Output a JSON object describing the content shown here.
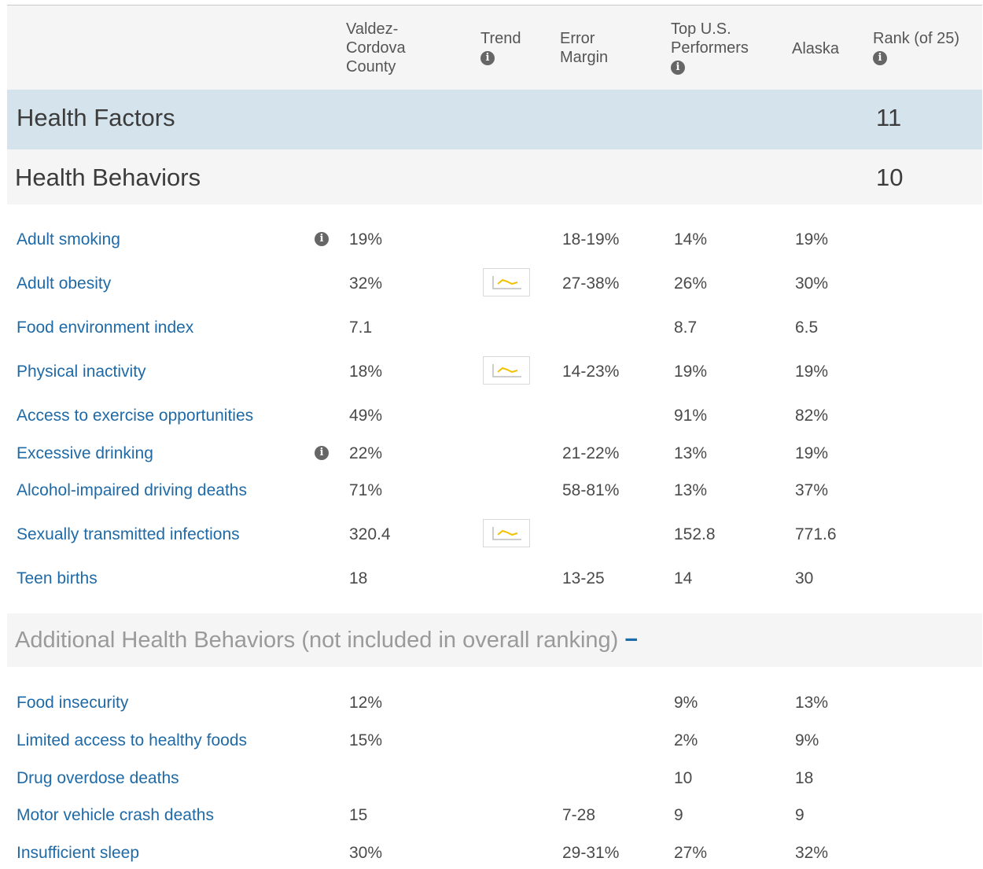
{
  "header": {
    "county": "Valdez-\nCordova\nCounty",
    "trend": "Trend",
    "error_margin": "Error\nMargin",
    "top_performers": "Top U.S.\nPerformers",
    "state": "Alaska",
    "rank": "Rank (of 25)",
    "info_glyph": "i"
  },
  "health_factors": {
    "title": "Health Factors",
    "rank": "11"
  },
  "health_behaviors": {
    "title": "Health Behaviors",
    "rank": "10",
    "rows": [
      {
        "measure": "Adult smoking",
        "info": true,
        "county": "19%",
        "trend": false,
        "error": "18-19%",
        "top": "14%",
        "state": "19%"
      },
      {
        "measure": "Adult obesity",
        "info": false,
        "county": "32%",
        "trend": true,
        "error": "27-38%",
        "top": "26%",
        "state": "30%"
      },
      {
        "measure": "Food environment index",
        "info": false,
        "county": "7.1",
        "trend": false,
        "error": "",
        "top": "8.7",
        "state": "6.5"
      },
      {
        "measure": "Physical inactivity",
        "info": false,
        "county": "18%",
        "trend": true,
        "error": "14-23%",
        "top": "19%",
        "state": "19%"
      },
      {
        "measure": "Access to exercise opportunities",
        "info": false,
        "county": "49%",
        "trend": false,
        "error": "",
        "top": "91%",
        "state": "82%"
      },
      {
        "measure": "Excessive drinking",
        "info": true,
        "county": "22%",
        "trend": false,
        "error": "21-22%",
        "top": "13%",
        "state": "19%"
      },
      {
        "measure": "Alcohol-impaired driving deaths",
        "info": false,
        "county": "71%",
        "trend": false,
        "error": "58-81%",
        "top": "13%",
        "state": "37%"
      },
      {
        "measure": "Sexually transmitted infections",
        "info": false,
        "county": "320.4",
        "trend": true,
        "error": "",
        "top": "152.8",
        "state": "771.6"
      },
      {
        "measure": "Teen births",
        "info": false,
        "county": "18",
        "trend": false,
        "error": "13-25",
        "top": "14",
        "state": "30"
      }
    ]
  },
  "additional": {
    "title": "Additional Health Behaviors (not included in overall ranking)",
    "toggle": "−",
    "rows": [
      {
        "measure": "Food insecurity",
        "county": "12%",
        "error": "",
        "top": "9%",
        "state": "13%"
      },
      {
        "measure": "Limited access to healthy foods",
        "county": "15%",
        "error": "",
        "top": "2%",
        "state": "9%"
      },
      {
        "measure": "Drug overdose deaths",
        "county": "",
        "error": "",
        "top": "10",
        "state": "18"
      },
      {
        "measure": "Motor vehicle crash deaths",
        "county": "15",
        "error": "7-28",
        "top": "9",
        "state": "9"
      },
      {
        "measure": "Insufficient sleep",
        "county": "30%",
        "error": "29-31%",
        "top": "27%",
        "state": "32%"
      }
    ]
  },
  "icons": {
    "info": "info-icon",
    "trend": "trend-chart-icon"
  },
  "colors": {
    "link": "#1f6aa6",
    "factors_bg": "#d5e3ec",
    "trend_line": "#f2c200"
  }
}
